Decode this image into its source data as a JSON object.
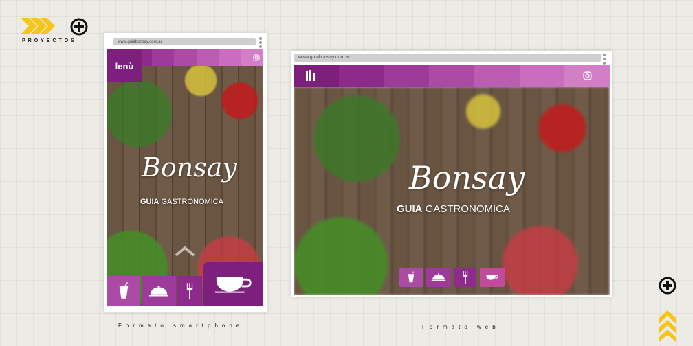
{
  "brand": {
    "label": "PROYECTOS",
    "accent": "#f5c518",
    "chevron_icon": "chevron-right-icon",
    "plus_icon": "plus-circle-icon"
  },
  "palette": [
    "#7d1f7d",
    "#8e2a8c",
    "#9e3a9a",
    "#ac4ba6",
    "#bb5db3",
    "#c96ebf",
    "#d27fc7"
  ],
  "mobile": {
    "url": "www.guiabonsay.com.ar",
    "menu_label": "lenù",
    "logo": "Bonsay",
    "subtitle_bold": "GUIA",
    "subtitle_rest": " GASTRONOMICA",
    "caption": "Formato smartphone",
    "icons": [
      "drink-icon",
      "cloche-icon",
      "fork-icon",
      "cup-icon"
    ],
    "instagram_icon": "instagram-icon",
    "up_icon": "chevron-up-icon"
  },
  "web": {
    "url": "www.guiabonsay.com.ar",
    "logo": "Bonsay",
    "subtitle_bold": "GUIA",
    "subtitle_rest": " GASTRONOMICA",
    "caption": "Formato web",
    "icons": [
      "drink-icon",
      "cloche-icon",
      "fork-icon",
      "cup-icon"
    ],
    "instagram_icon": "instagram-icon",
    "menu_icon": "menu-bars-icon"
  },
  "corner": {
    "plus_icon": "plus-circle-icon",
    "chevrons_icon": "chevron-up-icon"
  }
}
